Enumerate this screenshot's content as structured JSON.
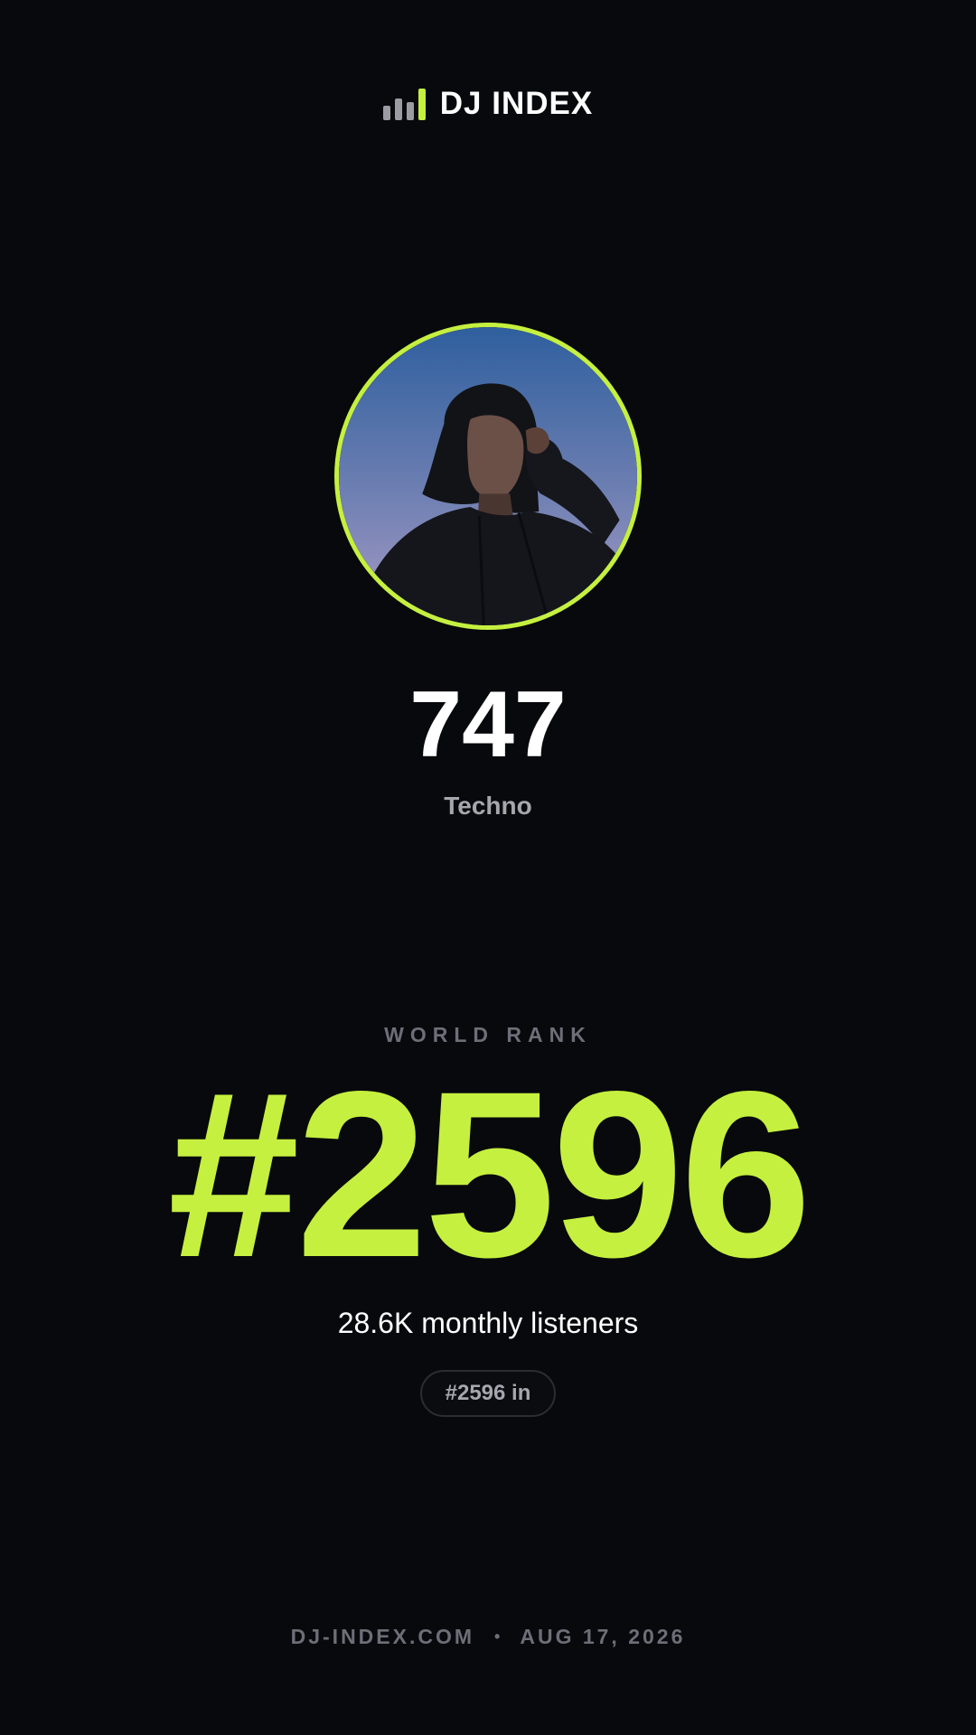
{
  "brand": {
    "name": "DJ INDEX",
    "icon": "bar-chart-icon",
    "accent_color": "#c5f03f"
  },
  "artist": {
    "name": "747",
    "genre": "Techno",
    "avatar_icon": "artist-photo"
  },
  "rank": {
    "label": "WORLD RANK",
    "value": "#2596"
  },
  "listeners": "28.6K monthly listeners",
  "chip": "#2596 in",
  "footer": {
    "site": "DJ-INDEX.COM",
    "separator": "•",
    "date": "AUG 17, 2026"
  },
  "colors": {
    "background": "#08090c",
    "accent": "#c5f03f",
    "muted": "#6c6f78"
  }
}
